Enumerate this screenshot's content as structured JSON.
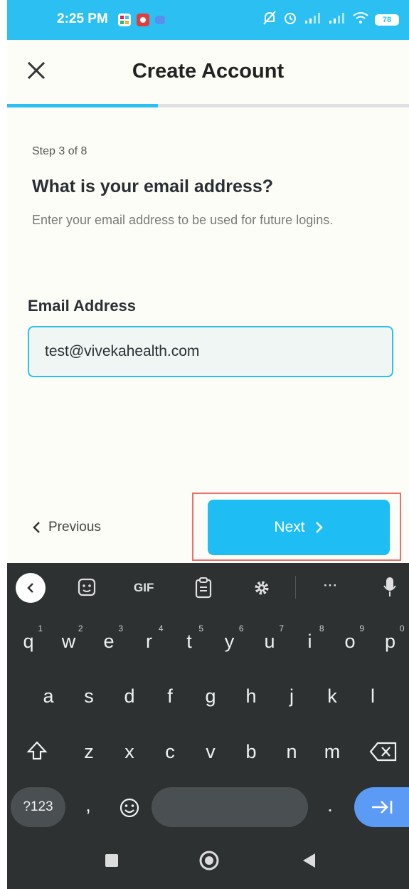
{
  "status_bar": {
    "time": "2:25 PM",
    "battery": "78"
  },
  "header": {
    "title": "Create Account"
  },
  "progress": {
    "fraction": 0.375
  },
  "form": {
    "step": "Step 3 of 8",
    "question": "What is your email address?",
    "subtitle": "Enter your email address to be used for future logins.",
    "field_label": "Email Address",
    "email_value": "test@vivekahealth.com"
  },
  "nav": {
    "previous_label": "Previous",
    "next_label": "Next"
  },
  "keyboard": {
    "toolbar": {
      "gif_label": "GIF",
      "more_label": "···"
    },
    "row1": [
      {
        "k": "q",
        "n": "1"
      },
      {
        "k": "w",
        "n": "2"
      },
      {
        "k": "e",
        "n": "3"
      },
      {
        "k": "r",
        "n": "4"
      },
      {
        "k": "t",
        "n": "5"
      },
      {
        "k": "y",
        "n": "6"
      },
      {
        "k": "u",
        "n": "7"
      },
      {
        "k": "i",
        "n": "8"
      },
      {
        "k": "o",
        "n": "9"
      },
      {
        "k": "p",
        "n": "0"
      }
    ],
    "row2": [
      "a",
      "s",
      "d",
      "f",
      "g",
      "h",
      "j",
      "k",
      "l"
    ],
    "row3": [
      "z",
      "x",
      "c",
      "v",
      "b",
      "n",
      "m"
    ],
    "sym_label": "?123",
    "comma": ",",
    "period": "."
  },
  "colors": {
    "accent": "#2cc0f2",
    "next_button": "#1ebef5",
    "highlight_border": "#ef6c6c",
    "keyboard_bg": "#2d3132"
  }
}
